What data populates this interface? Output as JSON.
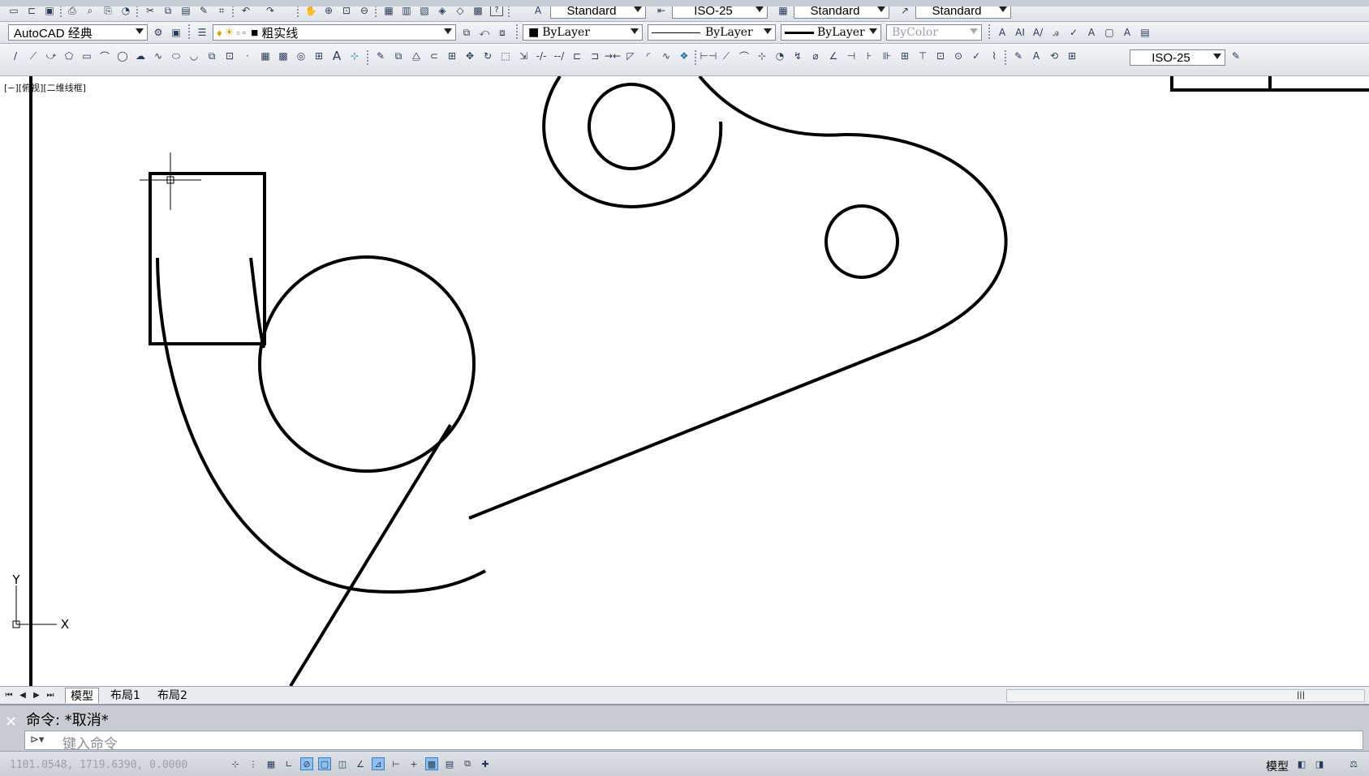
{
  "toolbar1": {
    "text_style": "Standard",
    "dim_style": "ISO-25",
    "table_style": "Standard",
    "multileader_style": "Standard"
  },
  "toolbar2": {
    "workspace": "AutoCAD 经典",
    "layer": "粗实线",
    "color": "ByLayer",
    "linetype": "ByLayer",
    "lineweight": "ByLayer",
    "plotstyle": "ByColor"
  },
  "toolbar3": {
    "dim_style": "ISO-25"
  },
  "viewport": {
    "label": "[−][俯视][二维线框]"
  },
  "ucs": {
    "x_label": "X",
    "y_label": "Y"
  },
  "layout_tabs": [
    "模型",
    "布局1",
    "布局2"
  ],
  "command": {
    "history": "命令: *取消*",
    "prompt": "键入命令"
  },
  "status": {
    "coordinates": "1101.0548, 1719.6390, 0.0000",
    "space": "模型"
  },
  "colors": {
    "canvas": "#ffffff",
    "stroke": "#000000",
    "toolbar": "#e6e9ed"
  }
}
